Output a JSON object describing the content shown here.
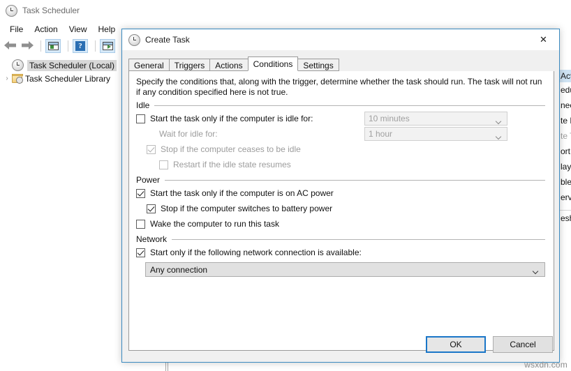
{
  "app": {
    "title": "Task Scheduler",
    "icon": "clock-icon",
    "menu": [
      "File",
      "Action",
      "View",
      "Help"
    ],
    "toolbar": [
      {
        "name": "back-arrow-icon",
        "label": "Back"
      },
      {
        "name": "forward-arrow-icon",
        "label": "Forward"
      },
      {
        "name": "show-console-tree-icon",
        "label": "Show/Hide Console Tree"
      },
      {
        "name": "help-icon",
        "label": "Help"
      },
      {
        "name": "show-action-pane-icon",
        "label": "Show/Hide Action Pane"
      }
    ],
    "tree": [
      {
        "label": "Task Scheduler (Local)",
        "icon": "clock-icon",
        "expander": "",
        "selected": true
      },
      {
        "label": "Task Scheduler Library",
        "icon": "folder-clock-icon",
        "expander": "›",
        "selected": false
      }
    ],
    "actions_pane": {
      "header": "Actions",
      "items": [
        {
          "label": "edule",
          "dim": false
        },
        {
          "label": "nect",
          "dim": false
        },
        {
          "label": "te Basic Task...",
          "dim": false
        },
        {
          "label": "te Task...",
          "dim": true
        },
        {
          "label": "ort Task...",
          "dim": false
        },
        {
          "label": "lay All Running Tasks",
          "dim": false
        },
        {
          "label": "ble All Tasks History",
          "dim": false
        },
        {
          "label": "erv Account Configuration",
          "dim": false
        },
        {
          "label": "",
          "dim": false
        },
        {
          "label": "esh",
          "dim": false
        },
        {
          "label": "",
          "dim": false
        }
      ]
    }
  },
  "dialog": {
    "title": "Create Task",
    "icon": "clock-icon",
    "close_label": "✕",
    "tabs": [
      {
        "label": "General",
        "active": false
      },
      {
        "label": "Triggers",
        "active": false
      },
      {
        "label": "Actions",
        "active": false
      },
      {
        "label": "Conditions",
        "active": true
      },
      {
        "label": "Settings",
        "active": false
      }
    ],
    "conditions": {
      "description": "Specify the conditions that, along with the trigger, determine whether the task should run.  The task will not run  if any condition specified here is not true.",
      "groups": [
        {
          "name": "Idle",
          "rows": [
            {
              "type": "checkbox",
              "label": "Start the task only if the computer is idle for:",
              "checked": false,
              "disabled": false,
              "indent": 0,
              "name": "start-only-if-idle-checkbox"
            },
            {
              "type": "label",
              "label": "Wait for idle for:",
              "disabled": true,
              "indent": 2,
              "name": "wait-for-idle-label"
            },
            {
              "type": "checkbox",
              "label": "Stop if the computer ceases to be idle",
              "checked": true,
              "disabled": true,
              "indent": 1,
              "name": "stop-if-not-idle-checkbox"
            },
            {
              "type": "checkbox",
              "label": "Restart if the idle state resumes",
              "checked": false,
              "disabled": true,
              "indent": 2,
              "name": "restart-if-idle-resumes-checkbox"
            }
          ]
        },
        {
          "name": "Power",
          "rows": [
            {
              "type": "checkbox",
              "label": "Start the task only if the computer is on AC power",
              "checked": true,
              "disabled": false,
              "indent": 0,
              "name": "start-only-on-ac-power-checkbox"
            },
            {
              "type": "checkbox",
              "label": "Stop if the computer switches to battery power",
              "checked": true,
              "disabled": false,
              "indent": 1,
              "name": "stop-on-battery-checkbox"
            },
            {
              "type": "checkbox",
              "label": "Wake the computer to run this task",
              "checked": false,
              "disabled": false,
              "indent": 0,
              "name": "wake-computer-checkbox"
            }
          ]
        },
        {
          "name": "Network",
          "rows": [
            {
              "type": "checkbox",
              "label": "Start only if the following network connection is available:",
              "checked": true,
              "disabled": false,
              "indent": 0,
              "name": "network-connection-checkbox"
            }
          ]
        }
      ],
      "idle_duration_combo": {
        "value": "10 minutes",
        "disabled": true
      },
      "wait_idle_combo": {
        "value": "1 hour",
        "disabled": true
      },
      "network_combo": {
        "value": "Any connection",
        "disabled": false
      }
    },
    "buttons": {
      "ok": "OK",
      "cancel": "Cancel"
    }
  },
  "watermark": "wsxdn.com",
  "colors": {
    "dialog_border": "#3a8ac0",
    "default_button_border": "#1a76c8",
    "toolbar_button_bg": "#d6e9f8",
    "tree_selection": "#d8d8d8"
  }
}
